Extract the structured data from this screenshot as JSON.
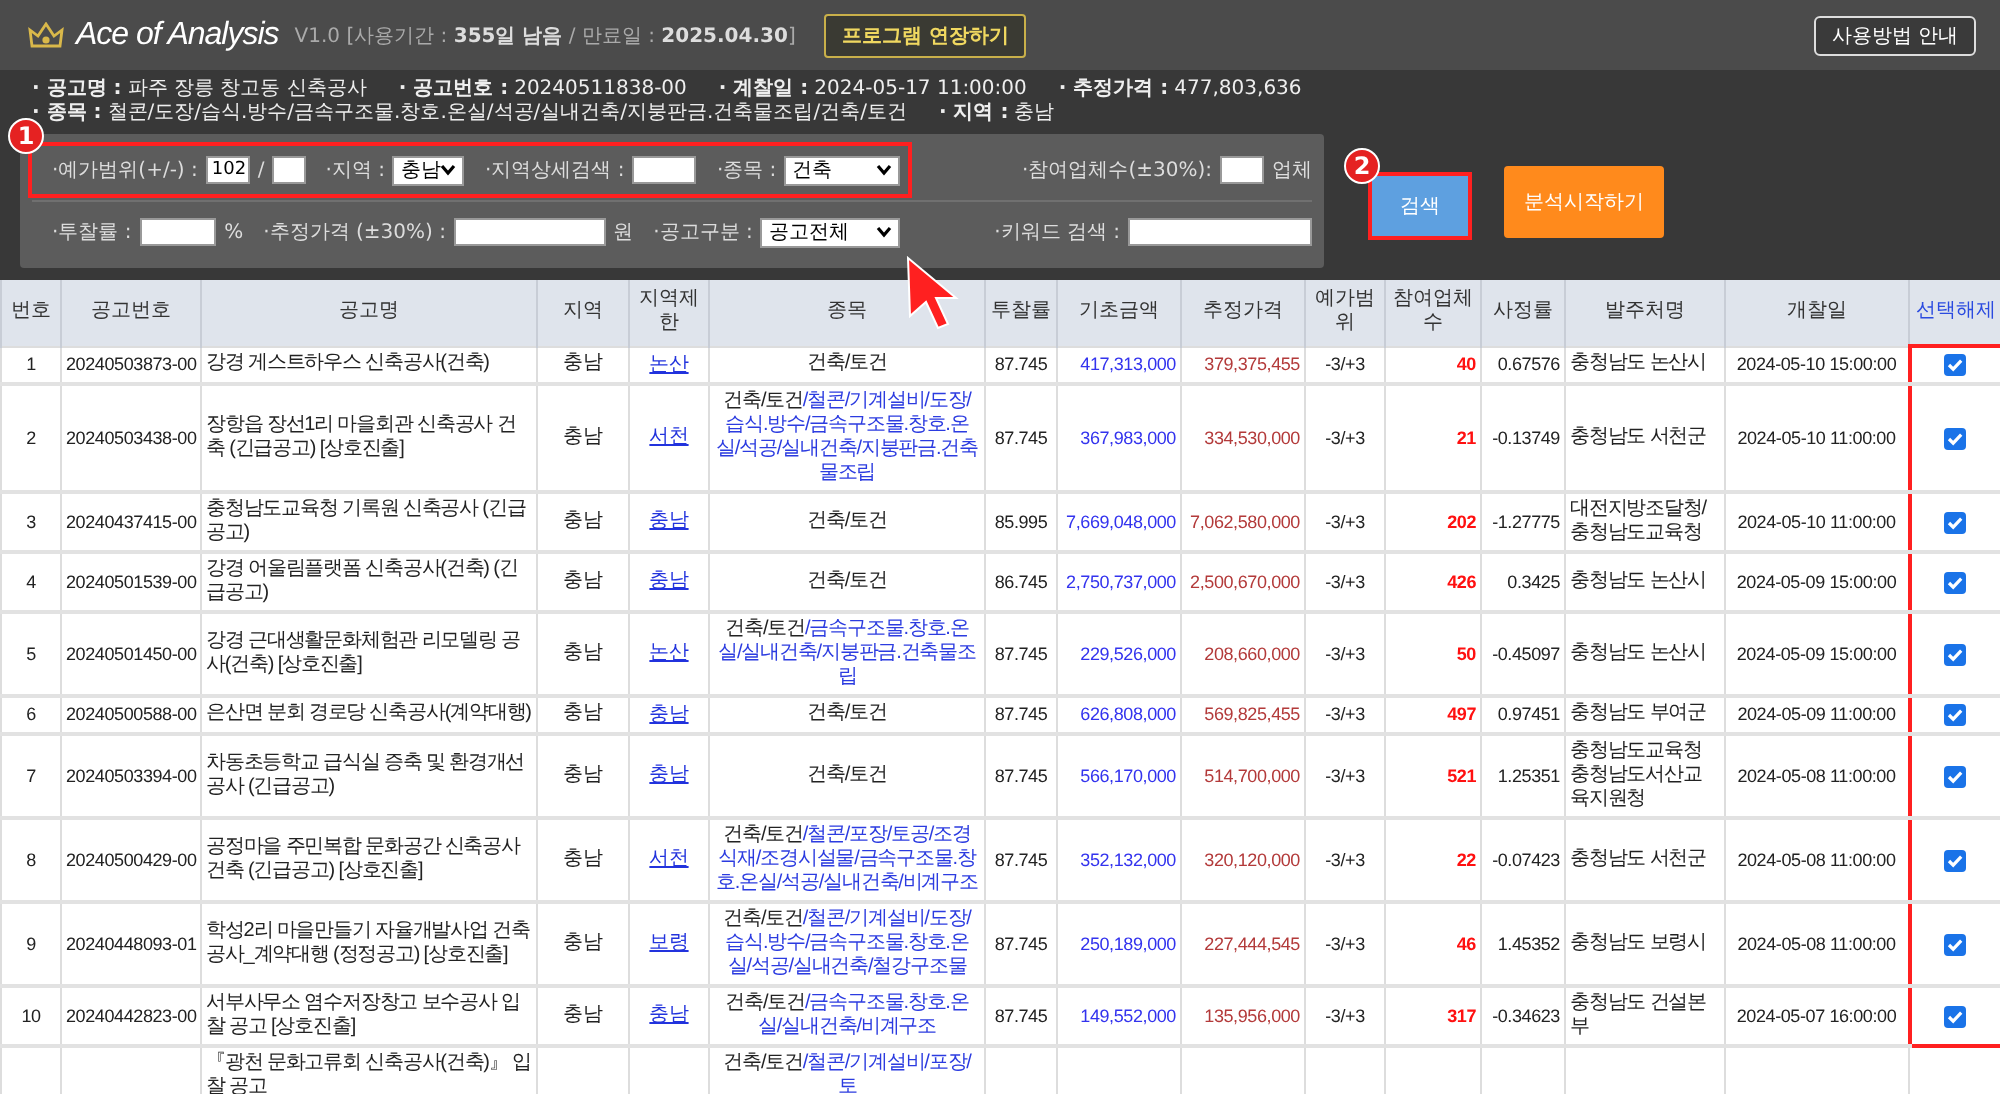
{
  "header": {
    "app_name": "Ace of Analysis",
    "license": "V1.0 [사용기간 : **355일 남음** / 만료일 : **2025.04.30**]",
    "extend_button": "프로그램 연장하기",
    "guide_button": "사용방법 안내"
  },
  "info": [
    [
      {
        "label": "· 공고명 :",
        "value": "파주 장릉 창고동 신축공사"
      },
      {
        "label": "· 공고번호 :",
        "value": "20240511838-00"
      },
      {
        "label": "· 계찰일 :",
        "value": "2024-05-17 11:00:00"
      },
      {
        "label": "· 추정가격 :",
        "value": "477,803,636"
      }
    ],
    [
      {
        "label": "· 종목 :",
        "value": "철콘/도장/습식.방수/금속구조물.창호.온실/석공/실내건축/지붕판금.건축물조립/건축/토건"
      },
      {
        "label": "· 지역 :",
        "value": "충남"
      }
    ]
  ],
  "filters": [
    {
      "left": [
        {
          "kind": "label",
          "text": "·예가범위(+/-) :"
        },
        {
          "kind": "input_small",
          "value": "102"
        },
        {
          "kind": "text",
          "text": "/"
        },
        {
          "kind": "input_small"
        },
        {
          "kind": "label",
          "text": "·지역 :"
        },
        {
          "kind": "select",
          "value": "충남"
        },
        {
          "kind": "label",
          "text": "·지역상세검색 :"
        },
        {
          "kind": "input"
        },
        {
          "kind": "label",
          "text": "·종목 :"
        },
        {
          "kind": "select_wide",
          "value": "건축"
        }
      ],
      "right": [
        {
          "kind": "label",
          "text": "·참여업체수(±30%):"
        },
        {
          "kind": "input_small"
        },
        {
          "kind": "text",
          "text": "업체"
        }
      ]
    },
    {
      "left": [
        {
          "kind": "label",
          "text": "·투찰률 :"
        },
        {
          "kind": "input"
        },
        {
          "kind": "text",
          "text": "%"
        },
        {
          "kind": "label",
          "text": "·추정가격 (±30%) :"
        },
        {
          "kind": "input_wide"
        },
        {
          "kind": "text",
          "text": "원"
        },
        {
          "kind": "label",
          "text": "·공고구분 :"
        },
        {
          "kind": "select_wide",
          "value": "공고전체"
        }
      ],
      "right": [
        {
          "kind": "label",
          "text": "·키워드 검색 :"
        },
        {
          "kind": "input_wide"
        }
      ]
    }
  ],
  "search_button": "검색",
  "analyze_button": "분석시작하기",
  "annotations": [
    {
      "label": "1"
    },
    {
      "label": "2"
    }
  ],
  "table": {
    "columns": [
      "번호",
      "공고번호",
      "공고명",
      "지역",
      "지역제한",
      "종목",
      "투찰률",
      "기초금액",
      "추정가격",
      "예가범위",
      "참여업체수",
      "사정률",
      "발주처명",
      "개찰일",
      "선택해제"
    ],
    "rows": [
      {
        "kind": "full",
        "no": "1",
        "id": "20240503873-00",
        "name": "강경 게스트하우스 신축공사(건축)",
        "region": "충남",
        "limit": "논산",
        "type_main": "건축/토건",
        "rate": "87.745",
        "base": "417,313,000",
        "est": "379,375,455",
        "range": "-3/+3",
        "bidders": "40",
        "adj": "0.67576",
        "orderer": "충청남도 논산시",
        "date": "2024-05-10 15:00:00",
        "checked": true
      },
      {
        "kind": "full",
        "no": "2",
        "id": "20240503438-00",
        "name": "장항읍 장선1리 마을회관 신축공사 건축 (긴급공고) [상호진출]",
        "region": "충남",
        "limit": "서천",
        "type_main": "건축/토건",
        "type_extra": "/철콘/기계설비/도장/습식.방수/금속구조물.창호.온실/석공/실내건축/지붕판금.건축물조립",
        "rate": "87.745",
        "base": "367,983,000",
        "est": "334,530,000",
        "range": "-3/+3",
        "bidders": "21",
        "adj": "-0.13749",
        "orderer": "충청남도 서천군",
        "date": "2024-05-10 11:00:00",
        "checked": true
      },
      {
        "kind": "full",
        "no": "3",
        "id": "20240437415-00",
        "name": "충청남도교육청 기록원 신축공사 (긴급공고)",
        "region": "충남",
        "limit": "충남",
        "type_main": "건축/토건",
        "rate": "85.995",
        "base": "7,669,048,000",
        "est": "7,062,580,000",
        "range": "-3/+3",
        "bidders": "202",
        "adj": "-1.27775",
        "orderer": "대전지방조달청/충청남도교육청",
        "date": "2024-05-10 11:00:00",
        "checked": true
      },
      {
        "kind": "full",
        "no": "4",
        "id": "20240501539-00",
        "name": "강경 어울림플랫폼 신축공사(건축) (긴급공고)",
        "region": "충남",
        "limit": "충남",
        "type_main": "건축/토건",
        "rate": "86.745",
        "base": "2,750,737,000",
        "est": "2,500,670,000",
        "range": "-3/+3",
        "bidders": "426",
        "adj": "0.3425",
        "orderer": "충청남도 논산시",
        "date": "2024-05-09 15:00:00",
        "checked": true
      },
      {
        "kind": "full",
        "no": "5",
        "id": "20240501450-00",
        "name": "강경 근대생활문화체험관 리모델링 공사(건축) [상호진출]",
        "region": "충남",
        "limit": "논산",
        "type_main": "건축/토건",
        "type_extra": "/금속구조물.창호.온실/실내건축/지붕판금.건축물조립",
        "rate": "87.745",
        "base": "229,526,000",
        "est": "208,660,000",
        "range": "-3/+3",
        "bidders": "50",
        "adj": "-0.45097",
        "orderer": "충청남도 논산시",
        "date": "2024-05-09 15:00:00",
        "checked": true
      },
      {
        "kind": "full",
        "no": "6",
        "id": "20240500588-00",
        "name": "은산면 분회 경로당 신축공사(계약대행)",
        "region": "충남",
        "limit": "충남",
        "type_main": "건축/토건",
        "rate": "87.745",
        "base": "626,808,000",
        "est": "569,825,455",
        "range": "-3/+3",
        "bidders": "497",
        "adj": "0.97451",
        "orderer": "충청남도 부여군",
        "date": "2024-05-09 11:00:00",
        "checked": true
      },
      {
        "kind": "full",
        "no": "7",
        "id": "20240503394-00",
        "name": "차동초등학교 급식실 증축 및 환경개선공사 (긴급공고)",
        "region": "충남",
        "limit": "충남",
        "type_main": "건축/토건",
        "rate": "87.745",
        "base": "566,170,000",
        "est": "514,700,000",
        "range": "-3/+3",
        "bidders": "521",
        "adj": "1.25351",
        "orderer": "충청남도교육청 충청남도서산교육지원청",
        "date": "2024-05-08 11:00:00",
        "checked": true
      },
      {
        "kind": "full",
        "no": "8",
        "id": "20240500429-00",
        "name": "공정마을 주민복합 문화공간 신축공사 건축 (긴급공고) [상호진출]",
        "region": "충남",
        "limit": "서천",
        "type_main": "건축/토건",
        "type_extra": "/철콘/포장/토공/조경식재/조경시설물/금속구조물.창호.온실/석공/실내건축/비계구조",
        "rate": "87.745",
        "base": "352,132,000",
        "est": "320,120,000",
        "range": "-3/+3",
        "bidders": "22",
        "adj": "-0.07423",
        "orderer": "충청남도 서천군",
        "date": "2024-05-08 11:00:00",
        "checked": true
      },
      {
        "kind": "full",
        "no": "9",
        "id": "20240448093-01",
        "name": "학성2리 마을만들기 자율개발사업 건축공사_계약대행 (정정공고) [상호진출]",
        "region": "충남",
        "limit": "보령",
        "type_main": "건축/토건",
        "type_extra": "/철콘/기계설비/도장/습식.방수/금속구조물.창호.온실/석공/실내건축/철강구조물",
        "rate": "87.745",
        "base": "250,189,000",
        "est": "227,444,545",
        "range": "-3/+3",
        "bidders": "46",
        "adj": "1.45352",
        "orderer": "충청남도 보령시",
        "date": "2024-05-08 11:00:00",
        "checked": true
      },
      {
        "kind": "full",
        "no": "10",
        "id": "20240442823-00",
        "name": "서부사무소 염수저장창고 보수공사 입찰 공고 [상호진출]",
        "region": "충남",
        "limit": "충남",
        "type_main": "건축/토건",
        "type_extra": "/금속구조물.창호.온실/실내건축/비계구조",
        "rate": "87.745",
        "base": "149,552,000",
        "est": "135,956,000",
        "range": "-3/+3",
        "bidders": "317",
        "adj": "-0.34623",
        "orderer": "충청남도 건설본부",
        "date": "2024-05-07 16:00:00",
        "checked": true
      },
      {
        "kind": "partial",
        "name": "『광천 문화고류회 신축공사(건축)』 입찰 공고",
        "type_main": "건축/토건",
        "type_extra": "/철콘/기계설비/포장/토"
      }
    ]
  }
}
